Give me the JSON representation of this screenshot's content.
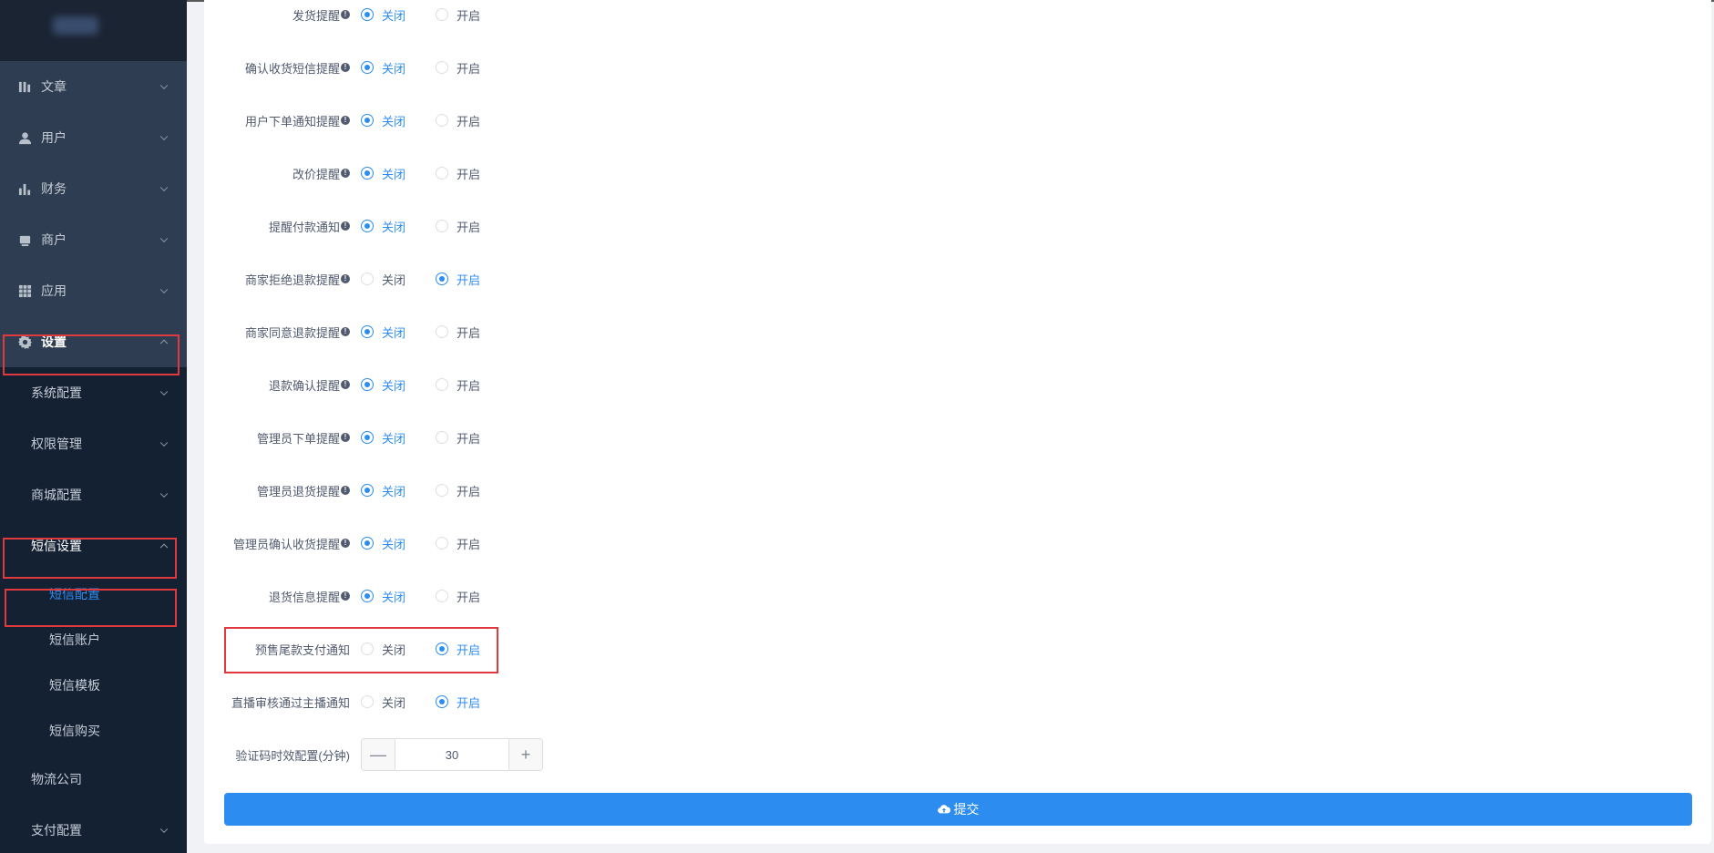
{
  "sidebar": {
    "menu": [
      {
        "label": "文章",
        "icon": "article-icon"
      },
      {
        "label": "用户",
        "icon": "user-icon"
      },
      {
        "label": "财务",
        "icon": "finance-icon"
      },
      {
        "label": "商户",
        "icon": "store-icon"
      },
      {
        "label": "应用",
        "icon": "apps-icon"
      },
      {
        "label": "设置",
        "icon": "gear-icon"
      }
    ],
    "settings_sub": [
      {
        "label": "系统配置"
      },
      {
        "label": "权限管理"
      },
      {
        "label": "商城配置"
      },
      {
        "label": "短信设置"
      }
    ],
    "sms_leaves": [
      {
        "label": "短信配置"
      },
      {
        "label": "短信账户"
      },
      {
        "label": "短信模板"
      },
      {
        "label": "短信购买"
      }
    ],
    "bottom_sub": [
      {
        "label": "物流公司"
      },
      {
        "label": "支付配置"
      }
    ]
  },
  "form": {
    "off_label": "关闭",
    "on_label": "开启",
    "rows": [
      {
        "label": "发货提醒",
        "info": true,
        "value": "off"
      },
      {
        "label": "确认收货短信提醒",
        "info": true,
        "value": "off"
      },
      {
        "label": "用户下单通知提醒",
        "info": true,
        "value": "off"
      },
      {
        "label": "改价提醒",
        "info": true,
        "value": "off"
      },
      {
        "label": "提醒付款通知",
        "info": true,
        "value": "off"
      },
      {
        "label": "商家拒绝退款提醒",
        "info": true,
        "value": "on"
      },
      {
        "label": "商家同意退款提醒",
        "info": true,
        "value": "off"
      },
      {
        "label": "退款确认提醒",
        "info": true,
        "value": "off"
      },
      {
        "label": "管理员下单提醒",
        "info": true,
        "value": "off"
      },
      {
        "label": "管理员退货提醒",
        "info": true,
        "value": "off"
      },
      {
        "label": "管理员确认收货提醒",
        "info": true,
        "value": "off"
      },
      {
        "label": "退货信息提醒",
        "info": true,
        "value": "off"
      },
      {
        "label": "预售尾款支付通知",
        "info": false,
        "value": "on"
      },
      {
        "label": "直播审核通过主播通知",
        "info": false,
        "value": "on"
      }
    ],
    "code_expiry": {
      "label": "验证码时效配置(分钟)",
      "value": "30",
      "minus": "—",
      "plus": "+"
    },
    "submit_label": "提交"
  },
  "colors": {
    "primary": "#2d8cf0",
    "highlight": "#e0393e",
    "sidebar_bg": "#1c2b3f"
  }
}
